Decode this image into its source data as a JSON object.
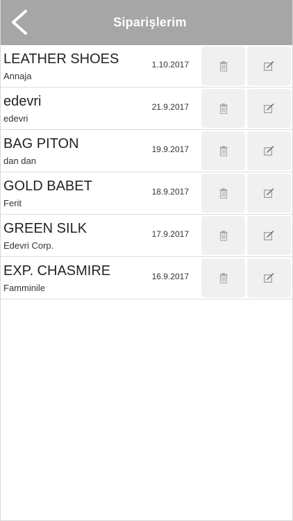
{
  "header": {
    "title": "Siparişlerim",
    "back_icon": "chevron-left-icon",
    "background": "#a6a6a6"
  },
  "orders": [
    {
      "name": "LEATHER SHOES",
      "customer": "Annaja",
      "date": "1.10.2017"
    },
    {
      "name": "edevri",
      "customer": "edevri",
      "date": "21.9.2017"
    },
    {
      "name": "BAG PITON",
      "customer": "dan dan",
      "date": "19.9.2017"
    },
    {
      "name": "GOLD BABET",
      "customer": "Ferit",
      "date": "18.9.2017"
    },
    {
      "name": "GREEN SILK",
      "customer": "Edevri Corp.",
      "date": "17.9.2017"
    },
    {
      "name": "EXP. CHASMIRE",
      "customer": "Famminile",
      "date": "16.9.2017"
    }
  ],
  "row_actions": {
    "delete_icon": "trash-icon",
    "edit_icon": "edit-icon"
  }
}
